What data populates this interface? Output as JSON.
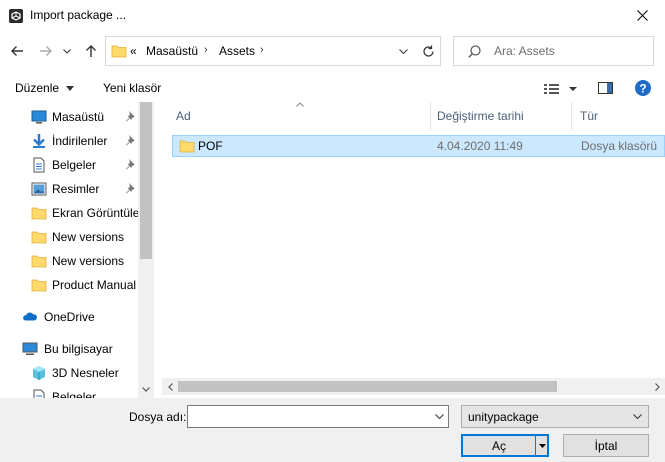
{
  "window": {
    "title": "Import package ...",
    "icon": "unity-icon",
    "close": "close-icon"
  },
  "nav": {
    "back_icon": "arrow-left-icon",
    "forward_icon": "arrow-right-icon",
    "recent_icon": "chevron-down-icon",
    "up_icon": "arrow-up-icon",
    "address": {
      "overflow": "«",
      "segments": [
        "Masaüstü",
        "Assets"
      ],
      "separator": "›"
    },
    "refresh_icon": "refresh-icon",
    "search_placeholder": "Ara: Assets"
  },
  "toolbar": {
    "organize": "Düzenle",
    "new_folder": "Yeni klasör",
    "view_icon": "view-options-icon",
    "preview_icon": "preview-pane-icon",
    "help_icon": "help-icon"
  },
  "sidebar": {
    "items": [
      {
        "label": "Masaüstü",
        "icon": "desktop-icon",
        "pinned": true
      },
      {
        "label": "İndirilenler",
        "icon": "download-icon",
        "pinned": true
      },
      {
        "label": "Belgeler",
        "icon": "documents-icon",
        "pinned": true
      },
      {
        "label": "Resimler",
        "icon": "pictures-icon",
        "pinned": true
      },
      {
        "label": "Ekran Görüntüle",
        "icon": "folder-icon",
        "pinned": false
      },
      {
        "label": "New versions",
        "icon": "folder-icon",
        "pinned": false
      },
      {
        "label": "New versions",
        "icon": "folder-icon",
        "pinned": false
      },
      {
        "label": "Product Manual",
        "icon": "folder-icon",
        "pinned": false
      },
      {
        "label": "OneDrive",
        "icon": "cloud-icon",
        "pinned": false
      },
      {
        "label": "Bu bilgisayar",
        "icon": "computer-icon",
        "pinned": false
      },
      {
        "label": "3D Nesneler",
        "icon": "cube-icon",
        "pinned": false
      },
      {
        "label": "Belgeler",
        "icon": "documents-icon",
        "pinned": false
      }
    ]
  },
  "filelist": {
    "columns": [
      "Ad",
      "Değiştirme tarihi",
      "Tür"
    ],
    "rows": [
      {
        "name": "POF",
        "modified": "4.04.2020 11:49",
        "type": "Dosya klasörü",
        "selected": true
      }
    ]
  },
  "footer": {
    "filename_label": "Dosya adı:",
    "filename_value": "",
    "filetype": "unitypackage",
    "open": "Aç",
    "cancel": "İptal"
  },
  "colors": {
    "selection": "#cce8ff",
    "accent": "#0078d7",
    "header_text": "#4c607a"
  }
}
